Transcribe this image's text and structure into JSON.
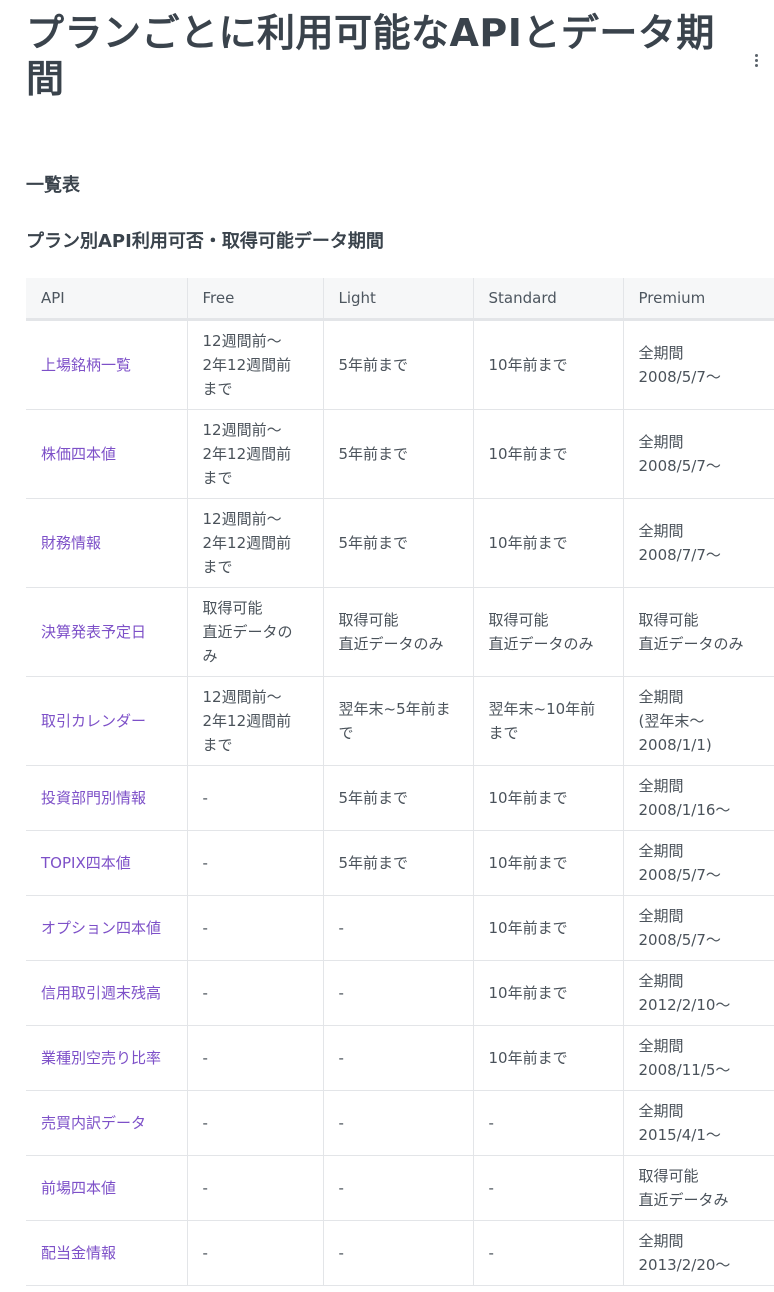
{
  "page": {
    "title": "プランごとに利用可能なAPIとデータ期間",
    "section_heading": "一覧表",
    "table_heading": "プラン別API利用可否・取得可能データ期間"
  },
  "table": {
    "headers": [
      "API",
      "Free",
      "Light",
      "Standard",
      "Premium"
    ],
    "rows": [
      {
        "api": "上場銘柄一覧",
        "free": [
          "12週間前〜",
          "2年12週間前",
          "まで"
        ],
        "light": [
          "5年前まで"
        ],
        "standard": [
          "10年前まで"
        ],
        "premium": [
          "全期間",
          "2008/5/7〜"
        ]
      },
      {
        "api": "株価四本値",
        "free": [
          "12週間前〜",
          "2年12週間前",
          "まで"
        ],
        "light": [
          "5年前まで"
        ],
        "standard": [
          "10年前まで"
        ],
        "premium": [
          "全期間",
          "2008/5/7〜"
        ]
      },
      {
        "api": "財務情報",
        "free": [
          "12週間前〜",
          "2年12週間前",
          "まで"
        ],
        "light": [
          "5年前まで"
        ],
        "standard": [
          "10年前まで"
        ],
        "premium": [
          "全期間",
          "2008/7/7〜"
        ]
      },
      {
        "api": "決算発表予定日",
        "free": [
          "取得可能",
          "直近データの",
          "み"
        ],
        "light": [
          "取得可能",
          "直近データのみ"
        ],
        "standard": [
          "取得可能",
          "直近データのみ"
        ],
        "premium": [
          "取得可能",
          "直近データのみ"
        ]
      },
      {
        "api": "取引カレンダー",
        "free": [
          "12週間前〜",
          "2年12週間前",
          "まで"
        ],
        "light": [
          "翌年末~5年前ま",
          "で"
        ],
        "standard": [
          "翌年末~10年前",
          "まで"
        ],
        "premium": [
          "全期間",
          "(翌年末〜",
          "2008/1/1)"
        ]
      },
      {
        "api": "投資部門別情報",
        "free": [
          "-"
        ],
        "light": [
          "5年前まで"
        ],
        "standard": [
          "10年前まで"
        ],
        "premium": [
          "全期間",
          "2008/1/16〜"
        ]
      },
      {
        "api": "TOPIX四本値",
        "free": [
          "-"
        ],
        "light": [
          "5年前まで"
        ],
        "standard": [
          "10年前まで"
        ],
        "premium": [
          "全期間",
          "2008/5/7〜"
        ]
      },
      {
        "api": "オプション四本値",
        "free": [
          "-"
        ],
        "light": [
          "-"
        ],
        "standard": [
          "10年前まで"
        ],
        "premium": [
          "全期間",
          "2008/5/7〜"
        ]
      },
      {
        "api": "信用取引週末残高",
        "free": [
          "-"
        ],
        "light": [
          "-"
        ],
        "standard": [
          "10年前まで"
        ],
        "premium": [
          "全期間",
          "2012/2/10〜"
        ]
      },
      {
        "api": "業種別空売り比率",
        "free": [
          "-"
        ],
        "light": [
          "-"
        ],
        "standard": [
          "10年前まで"
        ],
        "premium": [
          "全期間",
          "2008/11/5〜"
        ]
      },
      {
        "api": "売買内訳データ",
        "free": [
          "-"
        ],
        "light": [
          "-"
        ],
        "standard": [
          "-"
        ],
        "premium": [
          "全期間",
          "2015/4/1〜"
        ]
      },
      {
        "api": "前場四本値",
        "free": [
          "-"
        ],
        "light": [
          "-"
        ],
        "standard": [
          "-"
        ],
        "premium": [
          "取得可能",
          "直近データみ"
        ]
      },
      {
        "api": "配当金情報",
        "free": [
          "-"
        ],
        "light": [
          "-"
        ],
        "standard": [
          "-"
        ],
        "premium": [
          "全期間",
          "2013/2/20〜"
        ]
      }
    ]
  },
  "colors": {
    "link": "#7d50c8",
    "text": "#3a434c",
    "header_bg": "#f6f7f8",
    "border": "#e3e5e8"
  },
  "icons": {
    "menu": "kebab-menu-icon"
  }
}
